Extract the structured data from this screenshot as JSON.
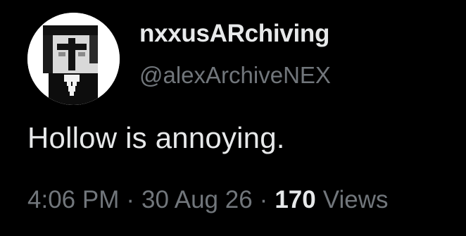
{
  "user": {
    "display_name": "nxxusARchiving",
    "handle": "@alexArchiveNEX",
    "avatar_icon": "pixel-character-avatar"
  },
  "tweet": {
    "text": "Hollow is annoying.",
    "time": "4:06 PM",
    "separator": "·",
    "date": "30 Aug 26",
    "view_count": "170",
    "views_label": "Views"
  },
  "colors": {
    "background": "#000000",
    "primary_text": "#e7e9ea",
    "secondary_text": "#71767b"
  }
}
